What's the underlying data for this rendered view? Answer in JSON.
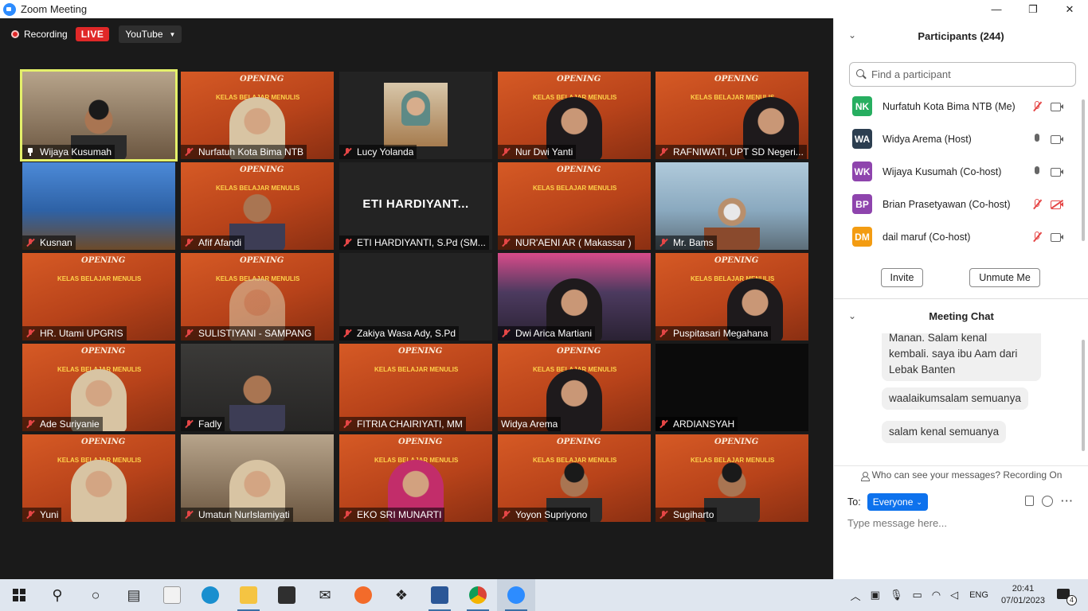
{
  "window": {
    "title": "Zoom Meeting",
    "minimize": "—",
    "restore": "❐",
    "close": "✕"
  },
  "recording": {
    "label": "Recording",
    "live": "LIVE",
    "stream_target": "YouTube"
  },
  "tiles": [
    {
      "name": "Wijaya Kusumah",
      "pinned": true
    },
    {
      "name": "Nurfatuh Kota Bima NTB"
    },
    {
      "name": "Lucy Yolanda"
    },
    {
      "name": "Nur Dwi Yanti"
    },
    {
      "name": "RAFNIWATI, UPT SD Negeri..."
    },
    {
      "name": "Kusnan"
    },
    {
      "name": "Afif Afandi"
    },
    {
      "name": "ETI HARDIYANTI, S.Pd (SM...",
      "initials": "ETI  HARDIYANT..."
    },
    {
      "name": "NUR'AENI AR  ( Makassar )"
    },
    {
      "name": "Mr. Bams"
    },
    {
      "name": "HR. Utami UPGRIS"
    },
    {
      "name": "SULISTIYANI - SAMPANG"
    },
    {
      "name": "Zakiya Wasa Ady, S.Pd"
    },
    {
      "name": "Dwi Arica Martiani"
    },
    {
      "name": "Puspitasari Megahana"
    },
    {
      "name": "Ade Suriyanie"
    },
    {
      "name": "Fadly"
    },
    {
      "name": "FITRIA CHAIRIYATI, MM"
    },
    {
      "name": "Widya Arema"
    },
    {
      "name": "ARDIANSYAH"
    },
    {
      "name": "Yuni"
    },
    {
      "name": "Umatun NurIslamiyati"
    },
    {
      "name": "EKO SRI MUNARTI"
    },
    {
      "name": "Yoyon Supriyono"
    },
    {
      "name": "Sugiharto"
    }
  ],
  "participants_panel": {
    "title": "Participants (244)",
    "search_placeholder": "Find a participant",
    "list": [
      {
        "initials": "NK",
        "name": "Nurfatuh Kota Bima NTB (Me)",
        "color": "#27ae60",
        "mic": "muted",
        "cam": "on"
      },
      {
        "initials": "WA",
        "name": "Widya Arema (Host)",
        "color": "#2c3e50",
        "mic": "on",
        "cam": "on"
      },
      {
        "initials": "WK",
        "name": "Wijaya Kusumah (Co-host)",
        "color": "#8e44ad",
        "mic": "on",
        "cam": "on"
      },
      {
        "initials": "BP",
        "name": "Brian Prasetyawan (Co-host)",
        "color": "#8e44ad",
        "mic": "muted",
        "cam": "off"
      },
      {
        "initials": "DM",
        "name": "dail maruf (Co-host)",
        "color": "#f39c12",
        "mic": "muted",
        "cam": "on"
      }
    ],
    "invite_label": "Invite",
    "unmute_label": "Unmute Me"
  },
  "chat_panel": {
    "title": "Meeting Chat",
    "messages": [
      "Manan. Salam kenal",
      "kembali. saya ibu Aam dari",
      "Lebak Banten",
      "waalaikumsalam semuanya",
      "salam kenal semuanya"
    ],
    "visibility_note": "Who can see your messages? Recording On",
    "to_label": "To:",
    "recipient": "Everyone",
    "input_placeholder": "Type message here..."
  },
  "taskbar": {
    "language": "ENG",
    "time": "20:41",
    "date": "07/01/2023",
    "notification_count": "4"
  }
}
